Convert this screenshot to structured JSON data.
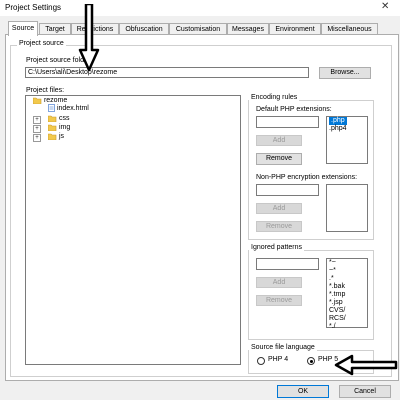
{
  "window": {
    "title": "Project Settings",
    "close_glyph": "✕"
  },
  "tabs": [
    "Source",
    "Target",
    "Restrictions",
    "Obfuscation",
    "Customisation",
    "Messages",
    "Environment",
    "Miscellaneous"
  ],
  "project_source": {
    "group_label": "Project source",
    "folder_label": "Project source folder:",
    "folder_value": "C:\\Users\\ali\\Desktop\\rezome",
    "browse_label": "Browse...",
    "files_label": "Project files:",
    "tree": {
      "root": "rezome",
      "file": "index.html",
      "folders": [
        "css",
        "img",
        "js"
      ]
    }
  },
  "encoding": {
    "group_label": "Encoding rules",
    "default_php_label": "Default PHP extensions:",
    "php_extensions": [
      ".php",
      ".php4"
    ],
    "non_php_label": "Non-PHP encryption extensions:",
    "add_label": "Add",
    "remove_label": "Remove"
  },
  "ignored": {
    "group_label": "Ignored patterns",
    "patterns": [
      "*~",
      "~*",
      ".*",
      "*.bak",
      "*.tmp",
      "*.jsp",
      "CVS/",
      "RCS/",
      "*./"
    ],
    "add_label": "Add",
    "remove_label": "Remove"
  },
  "language": {
    "group_label": "Source file language",
    "php4_label": "PHP 4",
    "php5_label": "PHP 5",
    "selected": "PHP 5"
  },
  "footer": {
    "ok_label": "OK",
    "cancel_label": "Cancel"
  },
  "annotations": {
    "arrow_color": "#000000"
  }
}
